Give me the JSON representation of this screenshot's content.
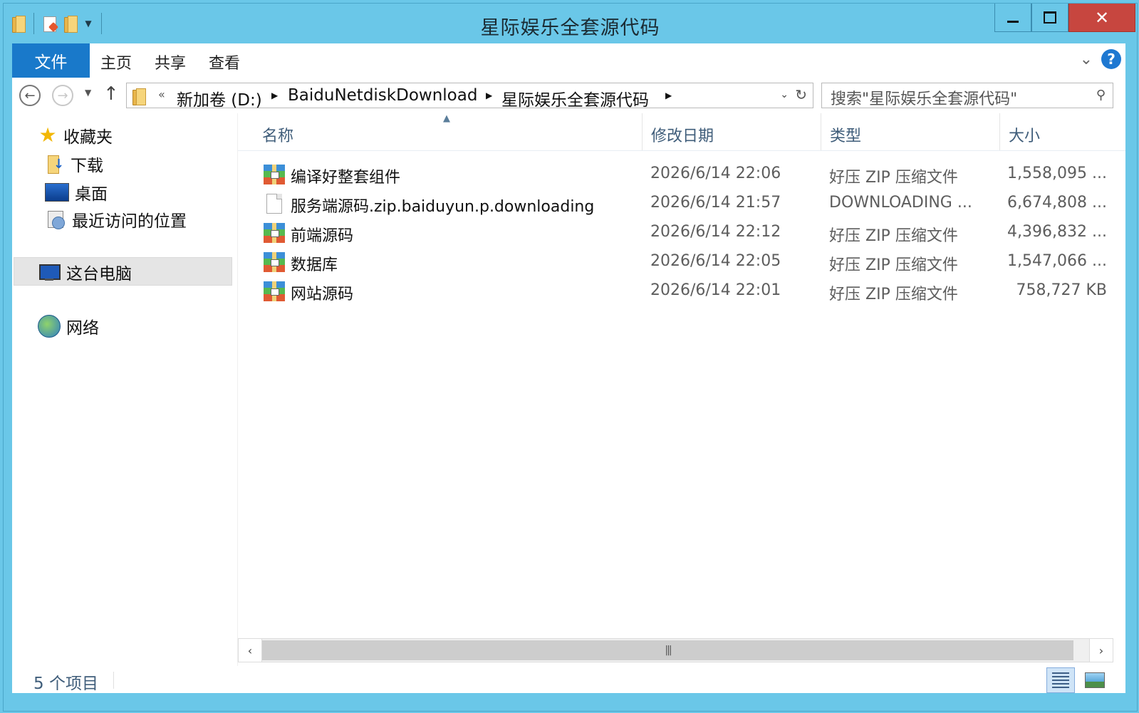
{
  "window": {
    "title": "星际娱乐全套源代码",
    "controls": {
      "minimize": "minimize",
      "maximize": "maximize",
      "close": "✕"
    }
  },
  "ribbon": {
    "file_tab": "文件",
    "tabs": [
      "主页",
      "共享",
      "查看"
    ]
  },
  "address": {
    "overflow": "«",
    "segments": [
      "新加卷 (D:)",
      "BaiduNetdiskDownload",
      "星际娱乐全套源代码"
    ]
  },
  "search": {
    "placeholder": "搜索\"星际娱乐全套源代码\""
  },
  "nav": {
    "favorites": "收藏夹",
    "downloads": "下载",
    "desktop": "桌面",
    "recent": "最近访问的位置",
    "this_pc": "这台电脑",
    "network": "网络"
  },
  "columns": {
    "name": "名称",
    "date": "修改日期",
    "type": "类型",
    "size": "大小"
  },
  "files": [
    {
      "name": "编译好整套组件",
      "date": "2026/6/14 22:06",
      "type": "好压 ZIP 压缩文件",
      "size": "1,558,095 ...",
      "icon": "zip-archive-icon"
    },
    {
      "name": "服务端源码.zip.baiduyun.p.downloading",
      "date": "2026/6/14 21:57",
      "type": "DOWNLOADING ...",
      "size": "6,674,808 ...",
      "icon": "blank-file-icon"
    },
    {
      "name": "前端源码",
      "date": "2026/6/14 22:12",
      "type": "好压 ZIP 压缩文件",
      "size": "4,396,832 ...",
      "icon": "zip-archive-icon"
    },
    {
      "name": "数据库",
      "date": "2026/6/14 22:05",
      "type": "好压 ZIP 压缩文件",
      "size": "1,547,066 ...",
      "icon": "zip-archive-icon"
    },
    {
      "name": "网站源码",
      "date": "2026/6/14 22:01",
      "type": "好压 ZIP 压缩文件",
      "size": "758,727 KB",
      "icon": "zip-archive-icon"
    }
  ],
  "status": {
    "item_count": "5 个项目"
  },
  "colors": {
    "titlebar": "#6ac7e8",
    "file_tab": "#1979ca",
    "close": "#c7463f",
    "header_text": "#3f5d7a"
  }
}
